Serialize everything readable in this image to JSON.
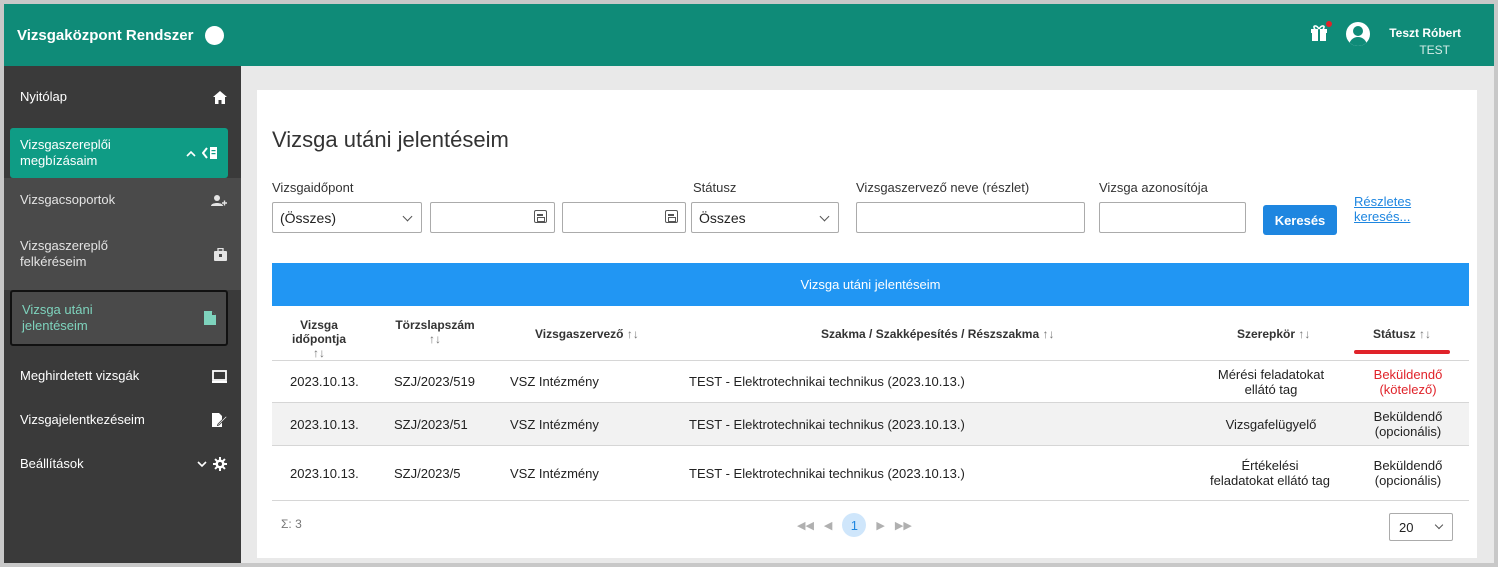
{
  "app": {
    "title": "Vizsgaközpont Rendszer"
  },
  "user": {
    "name": "Teszt Róbert",
    "org": "TEST"
  },
  "sidebar": {
    "items": [
      {
        "label": "Nyitólap",
        "icon": "home-icon"
      },
      {
        "label": "Vizsgaszereplői megbízásaim",
        "icon": "assignment-icon"
      },
      {
        "label": "Vizsgacsoportok",
        "icon": "group-icon"
      },
      {
        "label": "Vizsgaszereplő felkéréseim",
        "icon": "briefcase-icon"
      },
      {
        "label": "Vizsga utáni jelentéseim",
        "icon": "document-icon"
      },
      {
        "label": "Meghirdetett vizsgák",
        "icon": "monitor-icon"
      },
      {
        "label": "Vizsgajelentkezéseim",
        "icon": "edit-icon"
      },
      {
        "label": "Beállítások",
        "icon": "gear-icon"
      }
    ]
  },
  "page": {
    "title": "Vizsga utáni jelentéseim"
  },
  "filters": {
    "date_label": "Vizsgaidőpont",
    "date_select": "(Összes)",
    "status_label": "Státusz",
    "status_select": "Összes",
    "organizer_label": "Vizsgaszervező neve (részlet)",
    "exam_id_label": "Vizsga azonosítója",
    "search_button": "Keresés",
    "advanced_link": "Részletes keresés..."
  },
  "table": {
    "caption": "Vizsga utáni jelentéseim",
    "columns": [
      "Vizsga időpontja",
      "Törzslapszám",
      "Vizsgaszervező",
      "Szakma / Szakképesítés / Részszakma",
      "Szerepkör",
      "Státusz"
    ],
    "sort_glyph": "↑↓",
    "rows": [
      {
        "date": "2023.10.13.",
        "regno": "SZJ/2023/519",
        "organizer": "VSZ Intézmény",
        "profession": "TEST - Elektrotechnikai technikus (2023.10.13.)",
        "role": "Mérési feladatokat ellátó tag",
        "status": "Beküldendő (kötelező)",
        "status_color": "#e0232a"
      },
      {
        "date": "2023.10.13.",
        "regno": "SZJ/2023/51",
        "organizer": "VSZ Intézmény",
        "profession": "TEST - Elektrotechnikai technikus (2023.10.13.)",
        "role": "Vizsgafelügyelő",
        "status": "Beküldendő (opcionális)",
        "status_color": "#222222"
      },
      {
        "date": "2023.10.13.",
        "regno": "SZJ/2023/5",
        "organizer": "VSZ Intézmény",
        "profession": "TEST - Elektrotechnikai technikus (2023.10.13.)",
        "role": "Értékelési feladatokat ellátó tag",
        "status": "Beküldendő (opcionális)",
        "status_color": "#222222"
      }
    ],
    "sum_label": "Σ: 3",
    "page": "1",
    "page_size": "20"
  },
  "colors": {
    "primary": "#0f8b78",
    "accent": "#2196f3",
    "danger": "#e0232a"
  }
}
